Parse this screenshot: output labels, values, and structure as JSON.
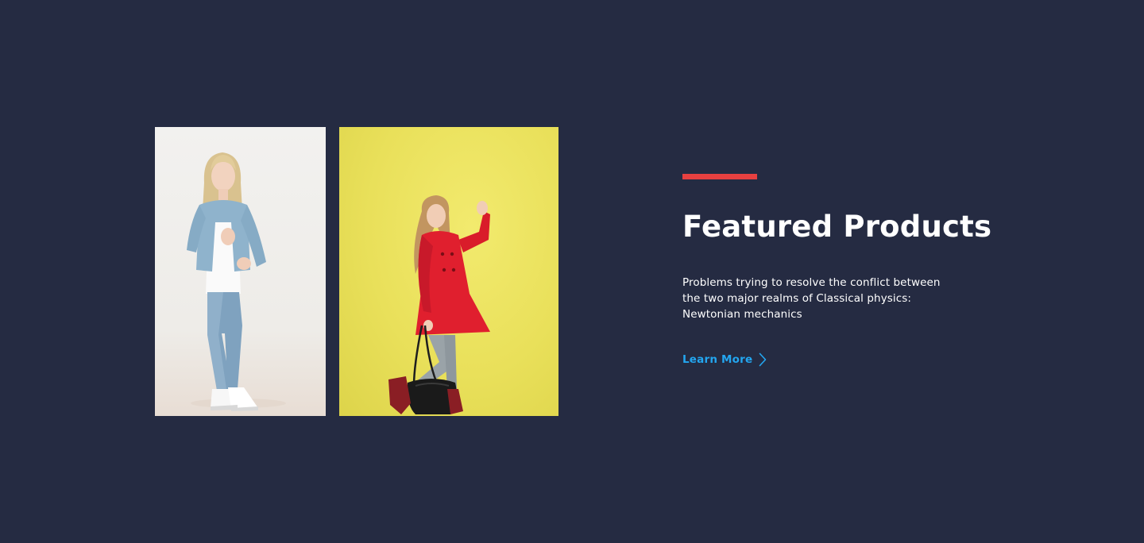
{
  "colors": {
    "background": "#252B42",
    "accent": "#E74040",
    "link": "#23A6F0",
    "text": "#FFFFFF"
  },
  "gallery": {
    "images": [
      {
        "name": "girl-denim-jacket-photo"
      },
      {
        "name": "girl-red-coat-photo"
      }
    ]
  },
  "featured": {
    "title": "Featured Products",
    "description_lines": [
      "Problems trying to resolve the conflict between",
      "the two major realms of Classical physics:",
      "Newtonian mechanics"
    ],
    "cta": {
      "label": "Learn More",
      "icon": "chevron-right-icon"
    }
  }
}
